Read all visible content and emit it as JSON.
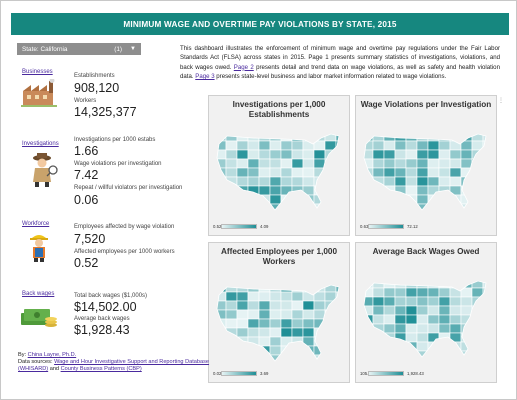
{
  "title": "MINIMUM WAGE AND OVERTIME PAY VIOLATIONS BY STATE, 2015",
  "state_filter": {
    "label": "State: California",
    "count": "(1)"
  },
  "intro": {
    "part1": "This dashboard illustrates the enforcement of minimum wage and overtime pay regulations under the Fair Labor Standards Act (FLSA) across states in 2015. Page 1 presents summary statistics of investigations, violations, and back wages owed.",
    "page2_link": "Page 2",
    "part2": "presents detail and trend data on wage violations, as well as safety and health violation data.",
    "page3_link": "Page 3",
    "part3": "presents state-level business and labor market information related to wage violations."
  },
  "sections": {
    "businesses": {
      "link": "Businesses",
      "establishments_label": "Establishments",
      "establishments_value": "908,120",
      "workers_label": "Workers",
      "workers_value": "14,325,377"
    },
    "investigations": {
      "link": "Investigations",
      "per1000_label": "Investigations per 1000 estabs",
      "per1000_value": "1.66",
      "wv_label": "Wage violations per investigation",
      "wv_value": "7.42",
      "repeat_label": "Repeat / willful violators per investigation",
      "repeat_value": "0.06"
    },
    "workforce": {
      "link": "Workforce",
      "affected_label": "Employees affected by wage violation",
      "affected_value": "7,520",
      "per1000_label": "Affected employees per 1000 workers",
      "per1000_value": "0.52"
    },
    "back_wages": {
      "link": "Back wages",
      "total_label": "Total back wages ($1,000s)",
      "total_value": "$14,502.00",
      "avg_label": "Average back wages",
      "avg_value": "$1,928.43"
    }
  },
  "maps": [
    {
      "title": "Investigations per 1,000 Establishments",
      "legend_min": "0.52",
      "legend_max": "4.09"
    },
    {
      "title": "Wage Violations per Investigation",
      "legend_min": "0.63",
      "legend_max": "72.12"
    },
    {
      "title": "Affected Employees per 1,000 Workers",
      "legend_min": "0.02",
      "legend_max": "3.69"
    },
    {
      "title": "Average Back Wages Owed",
      "legend_min": "105.81",
      "legend_max": "1,928.43"
    }
  ],
  "credits": {
    "by_prefix": "By:",
    "author": "China Layne, Ph.D.",
    "sources_prefix": "Data sources:",
    "source1": "Wage and Hour Investigative Support and Reporting Database (WHISARD)",
    "and": "and",
    "source2": "County Business Patterns (CBP)"
  },
  "colors": {
    "banner": "#16877f",
    "map_light": "#e6f3f4",
    "map_dark": "#1f8f96",
    "link": "#4a2a9e"
  },
  "icons": [
    "factory-icon",
    "detective-icon",
    "worker-icon",
    "money-icon",
    "dropdown-caret-icon",
    "more-options-icon"
  ]
}
